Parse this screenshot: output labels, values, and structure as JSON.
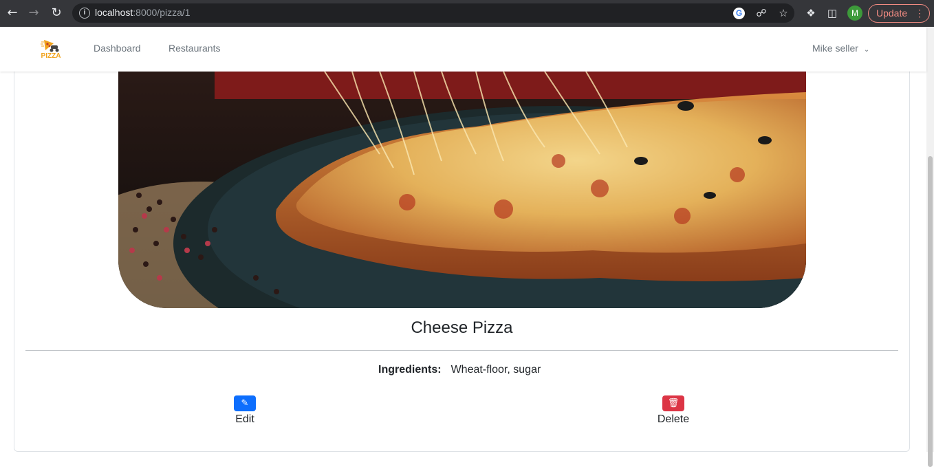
{
  "browser": {
    "url_host": "localhost",
    "url_path": ":8000/pizza/1",
    "avatar_initial": "M",
    "update_label": "Update",
    "google_letter": "G"
  },
  "navbar": {
    "logo_text": "PIZZA",
    "links": [
      "Dashboard",
      "Restaurants"
    ],
    "user_name": "Mike seller"
  },
  "pizza": {
    "name": "Cheese Pizza",
    "ingredients_label": "Ingredients:",
    "ingredients_value": "Wheat-floor, sugar"
  },
  "actions": {
    "edit_label": "Edit",
    "delete_label": "Delete"
  },
  "colors": {
    "primary": "#0d6efd",
    "danger": "#dc3545",
    "logo_accent": "#f0a21b"
  }
}
